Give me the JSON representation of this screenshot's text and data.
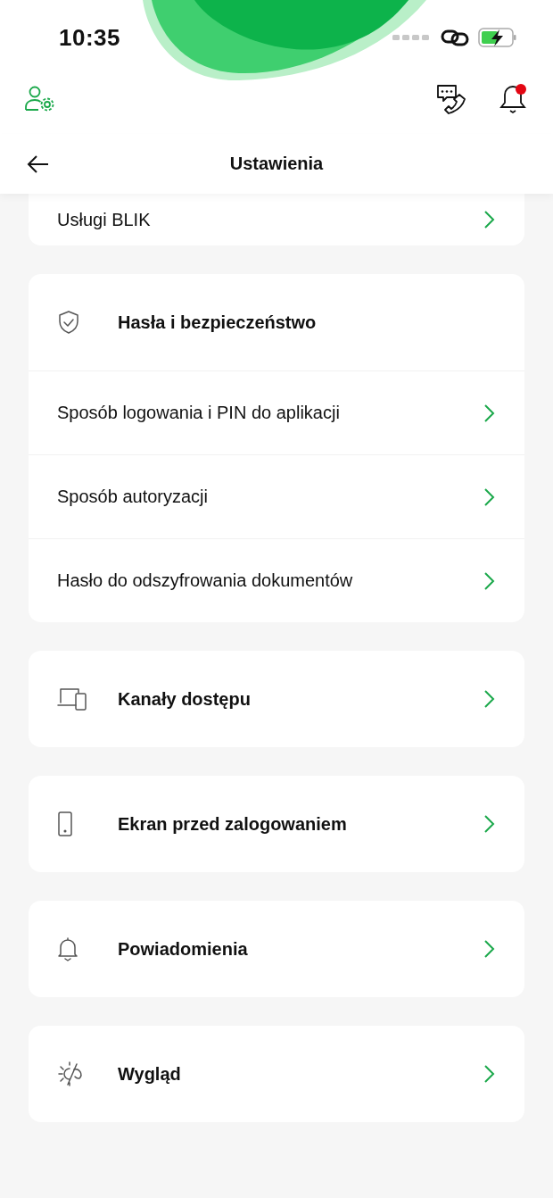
{
  "status_bar": {
    "time": "10:35"
  },
  "notifications": {
    "unread": true
  },
  "header": {
    "title": "Ustawienia"
  },
  "sections": [
    {
      "kind": "plain",
      "rows": [
        "Usługi BLIK"
      ]
    },
    {
      "kind": "group",
      "title": "Hasła i bezpieczeństwo",
      "rows": [
        "Sposób logowania i PIN do aplikacji",
        "Sposób autoryzacji",
        "Hasło do odszyfrowania dokumentów"
      ]
    },
    {
      "kind": "entry",
      "title": "Kanały dostępu"
    },
    {
      "kind": "entry",
      "title": "Ekran przed zalogowaniem"
    },
    {
      "kind": "entry",
      "title": "Powiadomienia"
    },
    {
      "kind": "entry",
      "title": "Wygląd"
    }
  ]
}
